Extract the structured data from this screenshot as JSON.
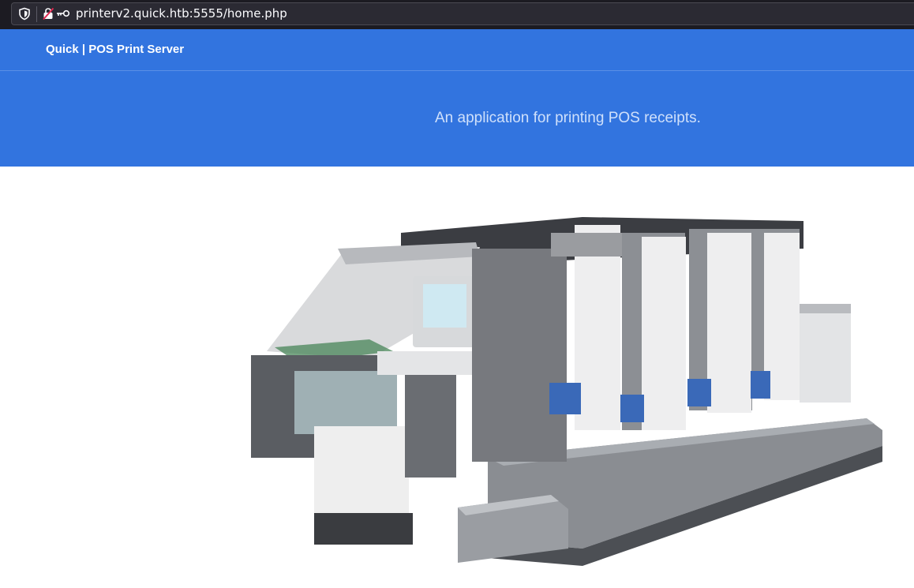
{
  "browser": {
    "url": "printerv2.quick.htb:5555/home.php",
    "icons": [
      "shield-icon",
      "insecure-lock-icon",
      "key-icon"
    ]
  },
  "navbar": {
    "brand": "Quick | POS Print Server"
  },
  "hero": {
    "tagline": "An application for printing POS receipts."
  },
  "main": {
    "image": "printing-press-image",
    "colors": {
      "header": "#3274df",
      "press_blue": "#3a69b8",
      "press_gray": "#8c8f94"
    }
  }
}
